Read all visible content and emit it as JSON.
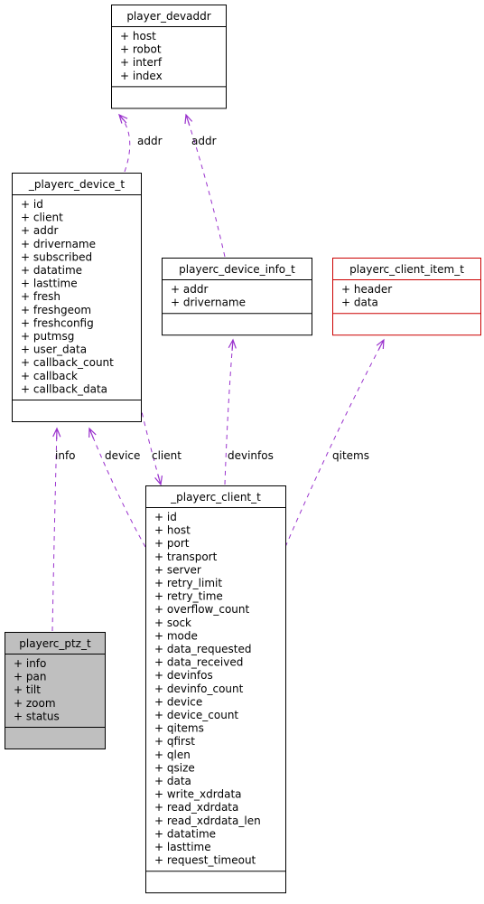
{
  "diagram": {
    "type": "collaboration-diagram",
    "colors": {
      "edge": "#9a32cd",
      "default_border": "#000000",
      "highlight_border": "#cc0000",
      "focus_fill": "#bfbfbf",
      "node_fill": "#ffffff"
    },
    "nodes": [
      {
        "id": "player_devaddr",
        "title": "player_devaddr",
        "fields": [
          "+ host",
          "+ robot",
          "+ interf",
          "+ index"
        ]
      },
      {
        "id": "playerc_device_t",
        "title": "_playerc_device_t",
        "fields": [
          "+ id",
          "+ client",
          "+ addr",
          "+ drivername",
          "+ subscribed",
          "+ datatime",
          "+ lasttime",
          "+ fresh",
          "+ freshgeom",
          "+ freshconfig",
          "+ putmsg",
          "+ user_data",
          "+ callback_count",
          "+ callback",
          "+ callback_data"
        ]
      },
      {
        "id": "playerc_device_info_t",
        "title": "playerc_device_info_t",
        "fields": [
          "+ addr",
          "+ drivername"
        ]
      },
      {
        "id": "playerc_client_item_t",
        "title": "playerc_client_item_t",
        "fields": [
          "+ header",
          "+ data"
        ]
      },
      {
        "id": "playerc_client_t",
        "title": "_playerc_client_t",
        "fields": [
          "+ id",
          "+ host",
          "+ port",
          "+ transport",
          "+ server",
          "+ retry_limit",
          "+ retry_time",
          "+ overflow_count",
          "+ sock",
          "+ mode",
          "+ data_requested",
          "+ data_received",
          "+ devinfos",
          "+ devinfo_count",
          "+ device",
          "+ device_count",
          "+ qitems",
          "+ qfirst",
          "+ qlen",
          "+ qsize",
          "+ data",
          "+ write_xdrdata",
          "+ read_xdrdata",
          "+ read_xdrdata_len",
          "+ datatime",
          "+ lasttime",
          "+ request_timeout"
        ]
      },
      {
        "id": "playerc_ptz_t",
        "title": "playerc_ptz_t",
        "fields": [
          "+ info",
          "+ pan",
          "+ tilt",
          "+ zoom",
          "+ status"
        ]
      }
    ],
    "edges": [
      {
        "from": "playerc_device_t",
        "to": "player_devaddr",
        "label": "addr"
      },
      {
        "from": "playerc_device_info_t",
        "to": "player_devaddr",
        "label": "addr"
      },
      {
        "from": "playerc_device_t",
        "to": "playerc_client_t",
        "label": "client"
      },
      {
        "from": "playerc_client_t",
        "to": "playerc_device_t",
        "label": "device"
      },
      {
        "from": "playerc_client_t",
        "to": "playerc_device_info_t",
        "label": "devinfos"
      },
      {
        "from": "playerc_client_t",
        "to": "playerc_client_item_t",
        "label": "qitems"
      },
      {
        "from": "playerc_ptz_t",
        "to": "playerc_device_t",
        "label": "info"
      }
    ]
  }
}
